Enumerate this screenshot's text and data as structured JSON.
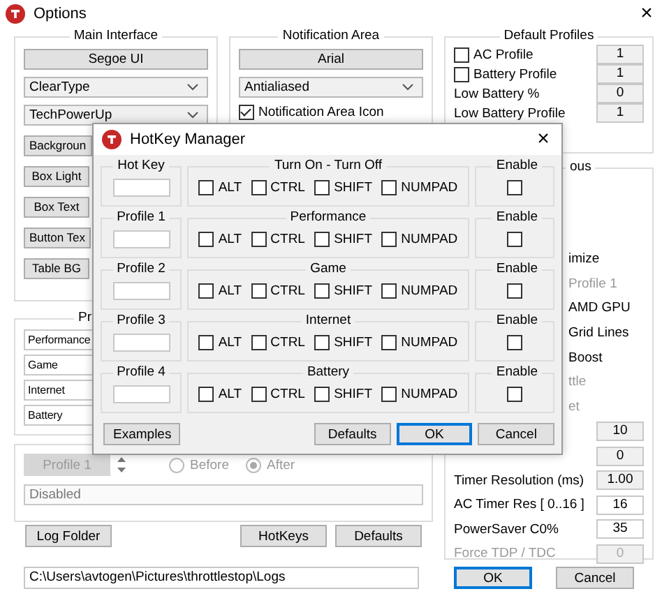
{
  "window": {
    "title": "Options",
    "close": "×"
  },
  "main_interface": {
    "title": "Main Interface",
    "font_button": "Segoe UI",
    "combos": [
      "ClearType",
      "TechPowerUp"
    ],
    "color_buttons": [
      "Backgroun",
      "Box Light",
      "Box Text",
      "Button Tex",
      "Table BG"
    ]
  },
  "notification_area": {
    "title": "Notification Area",
    "font_button": "Arial",
    "combos": [
      "Antialiased"
    ],
    "icon_checkbox": {
      "label": "Notification Area Icon",
      "checked": true
    }
  },
  "default_profiles": {
    "title": "Default Profiles",
    "rows": [
      {
        "kind": "checkbox",
        "label": "AC Profile",
        "checked": false,
        "value": "1"
      },
      {
        "kind": "checkbox",
        "label": "Battery Profile",
        "checked": false,
        "value": "1"
      },
      {
        "kind": "text",
        "label": "Low Battery %",
        "value": "0"
      },
      {
        "kind": "text",
        "label": "Low Battery Profile",
        "value": "1"
      }
    ]
  },
  "miscellaneous": {
    "title": "ous",
    "rows": [
      {
        "kind": "partial",
        "label": "imize",
        "disabled": false
      },
      {
        "kind": "partial",
        "label": "Profile 1",
        "disabled": true
      },
      {
        "kind": "partial",
        "label": "AMD GPU",
        "disabled": false
      },
      {
        "kind": "partial",
        "label": "Grid Lines",
        "disabled": false
      },
      {
        "kind": "partial",
        "label": "Boost",
        "disabled": false
      },
      {
        "kind": "partial",
        "label": "ttle",
        "disabled": true
      },
      {
        "kind": "partial",
        "label": "et",
        "disabled": true
      },
      {
        "kind": "value",
        "value": "10",
        "editable": false,
        "disabled": false
      },
      {
        "kind": "value",
        "value": "0",
        "editable": false,
        "disabled": false
      },
      {
        "kind": "value",
        "label": "Timer Resolution (ms)",
        "value": "1.00",
        "editable": false,
        "disabled": false
      },
      {
        "kind": "value",
        "label": "AC Timer Res [ 0..16 ]",
        "value": "16",
        "editable": true,
        "disabled": false
      },
      {
        "kind": "value",
        "label": "PowerSaver C0%",
        "value": "35",
        "editable": true,
        "disabled": false
      },
      {
        "kind": "value",
        "label": "Force TDP / TDC",
        "value": "0",
        "editable": false,
        "disabled": true
      }
    ]
  },
  "profiles": {
    "title": "Pr",
    "names": [
      "Performance",
      "Game",
      "Internet",
      "Battery"
    ]
  },
  "profile_order": {
    "profile": "Profile 1",
    "disabled": true,
    "options": [
      {
        "label": "Before",
        "selected": false
      },
      {
        "label": "After",
        "selected": true
      }
    ],
    "status": "Disabled"
  },
  "bottom_buttons": [
    "Log Folder",
    "HotKeys",
    "Defaults"
  ],
  "log_path": "C:\\Users\\avtogen\\Pictures\\throttlestop\\Logs",
  "dialog_buttons": [
    {
      "label": "OK",
      "focused": true
    },
    {
      "label": "Cancel",
      "focused": false
    }
  ],
  "hotkey_manager": {
    "title": "HotKey Manager",
    "close": "×",
    "rows": [
      {
        "key_label": "Hot Key",
        "group": "Turn On - Turn Off",
        "modifiers": [
          {
            "label": "ALT",
            "checked": false
          },
          {
            "label": "CTRL",
            "checked": false
          },
          {
            "label": "SHIFT",
            "checked": false
          },
          {
            "label": "NUMPAD",
            "checked": false
          }
        ],
        "enable_label": "Enable",
        "enabled": false
      },
      {
        "key_label": "Profile 1",
        "group": "Performance",
        "modifiers": [
          {
            "label": "ALT",
            "checked": false
          },
          {
            "label": "CTRL",
            "checked": false
          },
          {
            "label": "SHIFT",
            "checked": false
          },
          {
            "label": "NUMPAD",
            "checked": false
          }
        ],
        "enable_label": "Enable",
        "enabled": false
      },
      {
        "key_label": "Profile 2",
        "group": "Game",
        "modifiers": [
          {
            "label": "ALT",
            "checked": false
          },
          {
            "label": "CTRL",
            "checked": false
          },
          {
            "label": "SHIFT",
            "checked": false
          },
          {
            "label": "NUMPAD",
            "checked": false
          }
        ],
        "enable_label": "Enable",
        "enabled": false
      },
      {
        "key_label": "Profile 3",
        "group": "Internet",
        "modifiers": [
          {
            "label": "ALT",
            "checked": false
          },
          {
            "label": "CTRL",
            "checked": false
          },
          {
            "label": "SHIFT",
            "checked": false
          },
          {
            "label": "NUMPAD",
            "checked": false
          }
        ],
        "enable_label": "Enable",
        "enabled": false
      },
      {
        "key_label": "Profile 4",
        "group": "Battery",
        "modifiers": [
          {
            "label": "ALT",
            "checked": false
          },
          {
            "label": "CTRL",
            "checked": false
          },
          {
            "label": "SHIFT",
            "checked": false
          },
          {
            "label": "NUMPAD",
            "checked": false
          }
        ],
        "enable_label": "Enable",
        "enabled": false
      }
    ],
    "buttons": [
      {
        "label": "Examples",
        "focused": false
      },
      {
        "label": "Defaults",
        "focused": false
      },
      {
        "label": "OK",
        "focused": true
      },
      {
        "label": "Cancel",
        "focused": false
      }
    ]
  }
}
